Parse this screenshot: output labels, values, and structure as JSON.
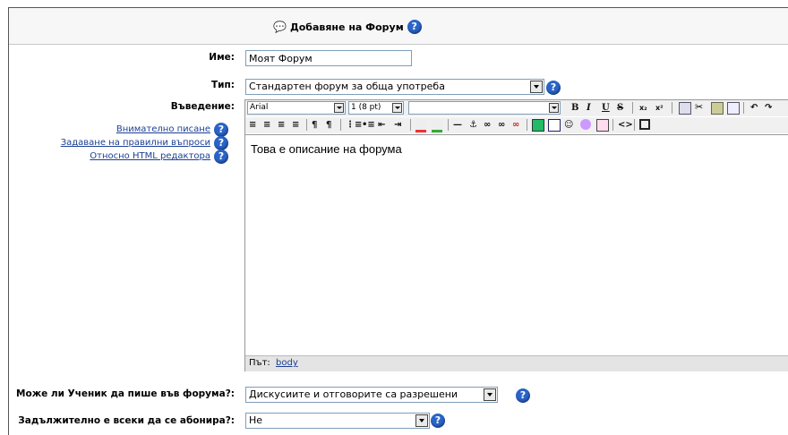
{
  "header": {
    "title": "Добавяне на Форум",
    "help": "?"
  },
  "form": {
    "name_label": "Име:",
    "name_value": "Моят Форум",
    "type_label": "Тип:",
    "type_value": "Стандартен форум за обща употреба",
    "intro_label": "Въведение:",
    "help_links": [
      "Внимателно писане",
      "Задаване на правилни въпроси",
      "Относно HTML редактора"
    ],
    "font_value": "Arial",
    "size_value": "1 (8 pt)",
    "style_value": "",
    "editor_text": "Това е описание на форума",
    "path_label": "Път:",
    "path_value": "body",
    "post_label": "Може ли Ученик да пише във форума?:",
    "post_value": "Дискусиите и отговорите са разрешени",
    "subscribe_label": "Задължително е всеки да се абонира?:",
    "subscribe_value": "Не"
  },
  "toolbar1": [
    "B",
    "I",
    "U",
    "S",
    "x₂",
    "x²"
  ],
  "colors": {
    "link": "#1c3f94",
    "help": "#2a64c8"
  }
}
